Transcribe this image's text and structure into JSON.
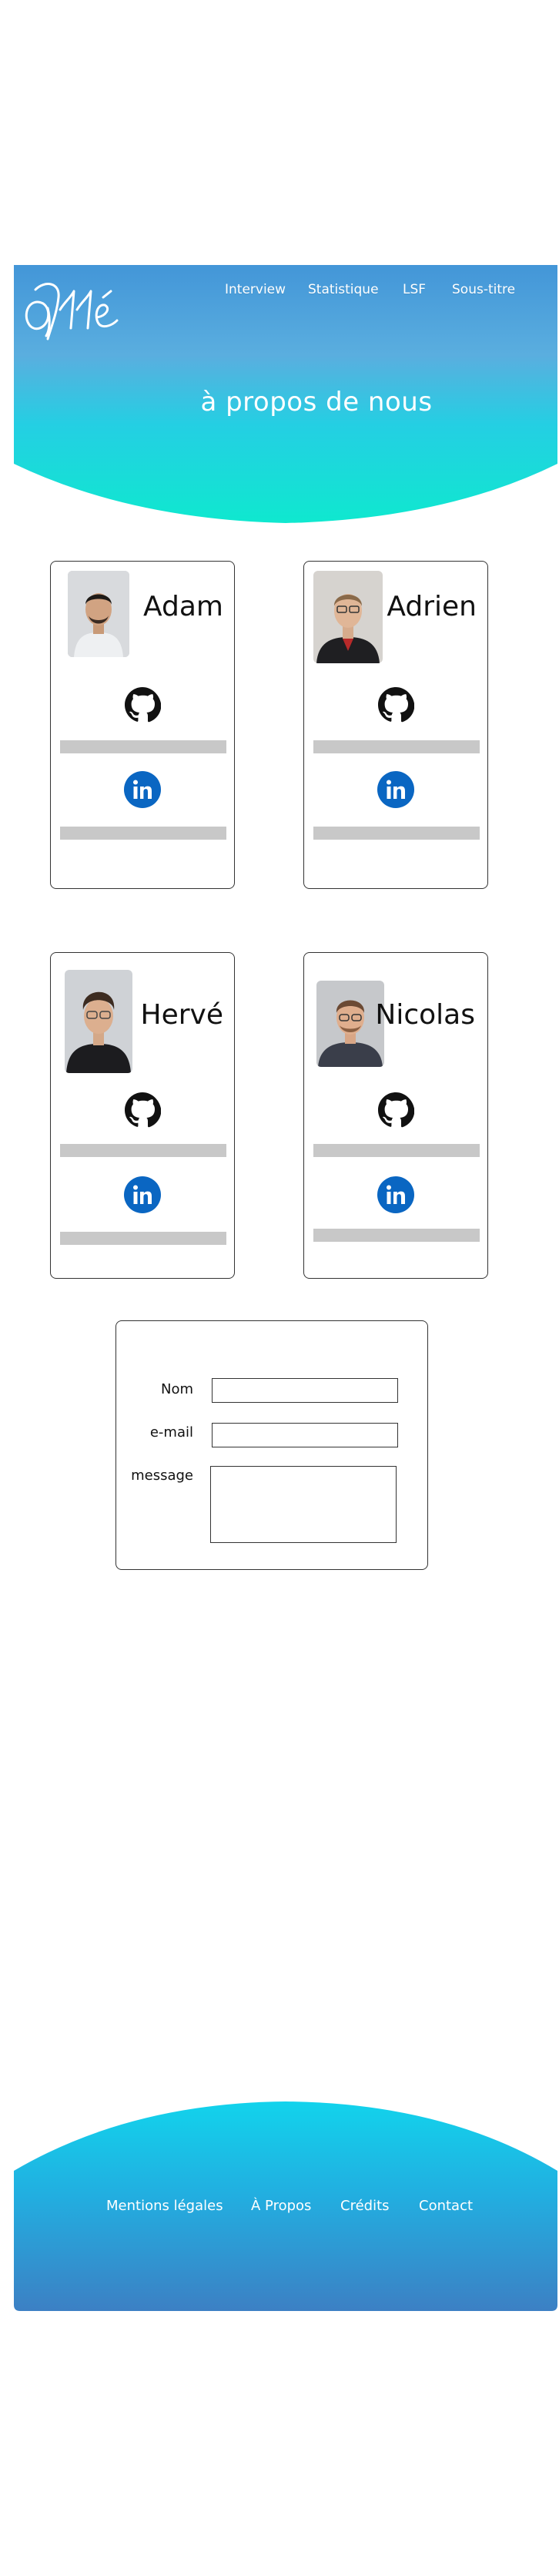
{
  "header": {
    "logo_text": "allé",
    "nav": [
      {
        "label": "Interview"
      },
      {
        "label": "Statistique"
      },
      {
        "label": "LSF"
      },
      {
        "label": "Sous-titre"
      }
    ],
    "title": "à propos de nous"
  },
  "members": [
    {
      "name": "Adam"
    },
    {
      "name": "Adrien"
    },
    {
      "name": "Hervé"
    },
    {
      "name": "Nicolas"
    }
  ],
  "contact": {
    "name_label": "Nom",
    "email_label": "e-mail",
    "message_label": "message",
    "name_value": "",
    "email_value": "",
    "message_value": ""
  },
  "footer": {
    "links": [
      {
        "label": "Mentions légales"
      },
      {
        "label": "À Propos"
      },
      {
        "label": "Crédits"
      },
      {
        "label": "Contact"
      }
    ]
  },
  "colors": {
    "gradient_top": "#3a8fd6",
    "gradient_mid": "#1fd1e6",
    "gradient_bottom": "#12e5cf",
    "footer_top": "#16c9ea",
    "footer_bottom": "#3b7fc4",
    "github": "#111111",
    "linkedin": "#0a66c2",
    "placeholder_bar": "#c8c8c8"
  },
  "icons": {
    "github": "github-icon",
    "linkedin": "linkedin-icon"
  }
}
